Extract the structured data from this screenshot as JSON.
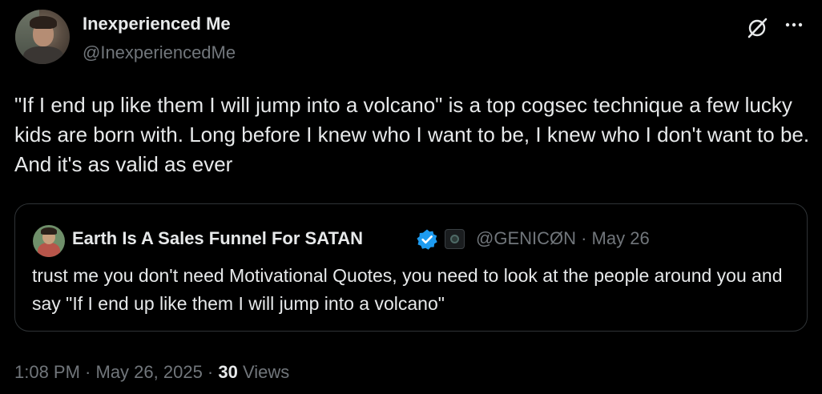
{
  "author": {
    "display_name": "Inexperienced Me",
    "handle": "@InexperiencedMe"
  },
  "tweet": {
    "text": "\"If I end up like them I will jump into a volcano\" is a top cogsec technique a few lucky kids are born with. Long before I knew who I want to be, I knew who I don't want to be. And it's as valid as ever"
  },
  "quoted": {
    "display_name": "Earth Is A Sales Funnel For SATAN",
    "meta": "@GENICØN · May 26",
    "text": "trust me you don't need Motivational Quotes, you need to look at the people around you and say \"If I end up like them I will jump into a volcano\""
  },
  "footer": {
    "time": "1:08 PM",
    "sep1": " · ",
    "date": "May 26, 2025",
    "sep2": " · ",
    "views_count": "30",
    "views_label": " Views"
  },
  "icons": {
    "grok": "grok-icon",
    "more": "more-icon",
    "verified": "verified-icon"
  },
  "colors": {
    "background": "#000000",
    "text_primary": "#e7e9ea",
    "text_secondary": "#71767b",
    "border": "#2f3336",
    "verified_blue": "#1d9bf0"
  }
}
